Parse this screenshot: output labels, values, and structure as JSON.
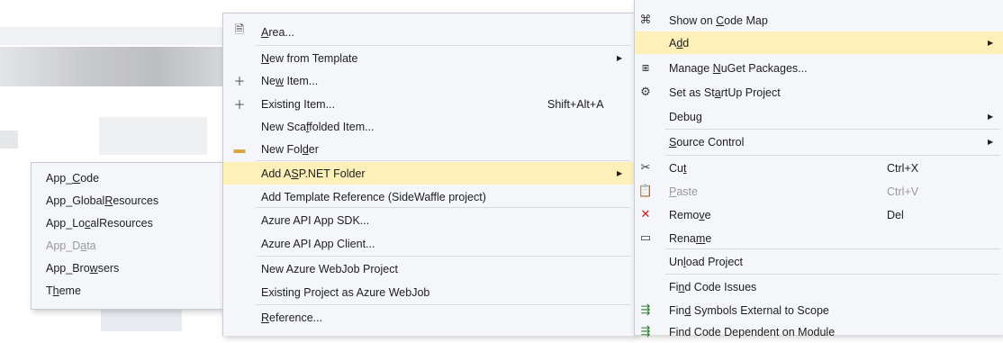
{
  "left_menu": {
    "items": [
      {
        "pre": "App_",
        "ul": "C",
        "post": "ode"
      },
      {
        "pre": "App_Global",
        "ul": "R",
        "post": "esources"
      },
      {
        "pre": "App_Lo",
        "ul": "c",
        "post": "alResources"
      },
      {
        "pre": "App_D",
        "ul": "a",
        "post": "ta"
      },
      {
        "pre": "App_Bro",
        "ul": "w",
        "post": "sers"
      },
      {
        "pre": "T",
        "ul": "h",
        "post": "eme"
      }
    ]
  },
  "middle_menu": {
    "items": [
      {
        "pre": "",
        "ul": "A",
        "post": "rea...",
        "icon": "🗎"
      },
      {
        "pre": "",
        "ul": "N",
        "post": "ew from Template"
      },
      {
        "pre": "Ne",
        "ul": "w",
        "post": " Item...",
        "icon": "＋"
      },
      {
        "pre": "Existin",
        "ul": "g",
        "post": " Item...",
        "icon": "＋",
        "shortcut": "Shift+Alt+A"
      },
      {
        "pre": "New Sca",
        "ul": "f",
        "post": "folded Item..."
      },
      {
        "pre": "New Fol",
        "ul": "d",
        "post": "er",
        "icon": "▬"
      },
      {
        "pre": "Add A",
        "ul": "S",
        "post": "P.NET Folder"
      },
      {
        "pre": "Add Template Reference (SideWaffle project)",
        "ul": "",
        "post": ""
      },
      {
        "pre": "Azure API App SDK...",
        "ul": "",
        "post": ""
      },
      {
        "pre": "Azure API App Client...",
        "ul": "",
        "post": ""
      },
      {
        "pre": "New Azure WebJob Project",
        "ul": "",
        "post": ""
      },
      {
        "pre": "Existing Project as Azure WebJob",
        "ul": "",
        "post": ""
      },
      {
        "pre": "",
        "ul": "R",
        "post": "eference..."
      }
    ]
  },
  "right_menu": {
    "items": [
      {
        "pre": "Show on ",
        "ul": "C",
        "post": "ode Map",
        "icon": "⌘"
      },
      {
        "pre": "A",
        "ul": "d",
        "post": "d"
      },
      {
        "pre": "Manage ",
        "ul": "N",
        "post": "uGet Packages...",
        "icon": "⧆"
      },
      {
        "pre": "Set as St",
        "ul": "a",
        "post": "rtUp Project",
        "icon": "⚙"
      },
      {
        "pre": "Debu",
        "ul": "g",
        "post": ""
      },
      {
        "pre": "",
        "ul": "S",
        "post": "ource Control"
      },
      {
        "pre": "Cu",
        "ul": "t",
        "post": "",
        "icon": "✂",
        "shortcut": "Ctrl+X"
      },
      {
        "pre": "",
        "ul": "P",
        "post": "aste",
        "icon": "📋",
        "shortcut": "Ctrl+V"
      },
      {
        "pre": "Remo",
        "ul": "v",
        "post": "e",
        "icon": "✕",
        "shortcut": "Del"
      },
      {
        "pre": "Rena",
        "ul": "m",
        "post": "e",
        "icon": "▭"
      },
      {
        "pre": "Un",
        "ul": "l",
        "post": "oad Project"
      },
      {
        "pre": "Fi",
        "ul": "n",
        "post": "d Code Issues"
      },
      {
        "pre": "Fin",
        "ul": "d",
        "post": " Symbols External to Scope",
        "icon": "⇶"
      },
      {
        "pre": "Find Code Dependent on Module",
        "ul": "",
        "post": "",
        "icon": "⇶"
      }
    ]
  },
  "colors": {
    "highlight": "#fdf0b8",
    "menu_bg": "#f5f6fa",
    "disabled": "#9a9a9a",
    "remove_icon": "#d11919"
  }
}
